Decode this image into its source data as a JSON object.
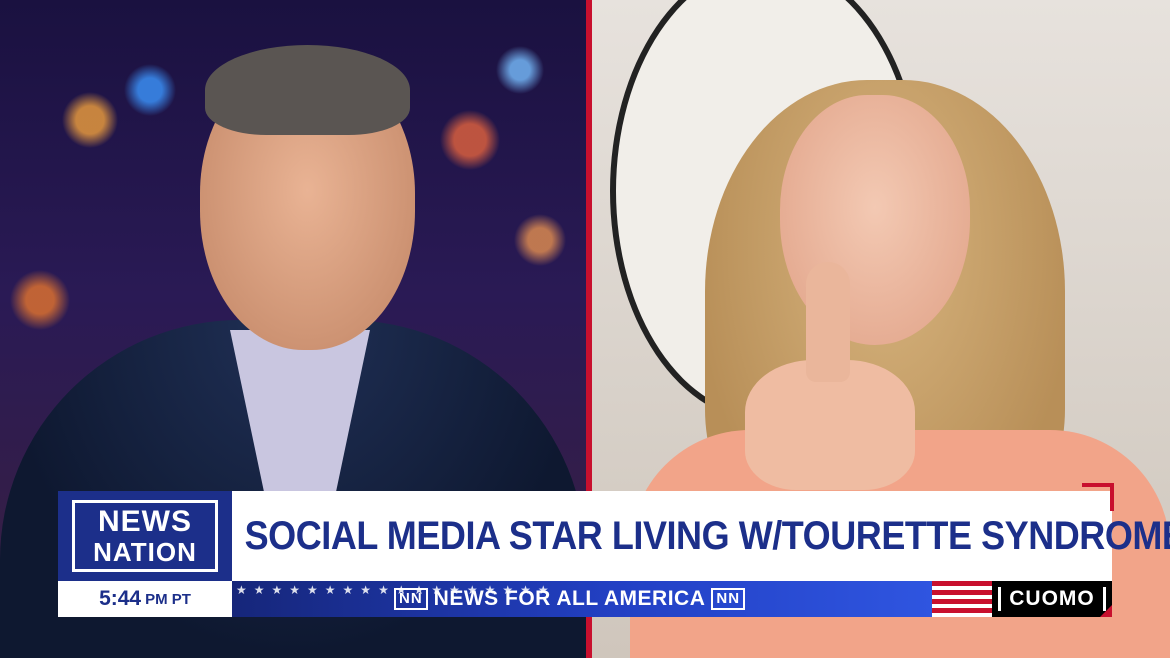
{
  "network": {
    "logo_line1": "NEWS",
    "logo_line2": "NATION",
    "brand_color": "#1c2f8a",
    "accent_color": "#c8102e"
  },
  "headline": "SOCIAL MEDIA STAR LIVING W/TOURETTE SYNDROME",
  "clock": {
    "time": "5:44",
    "suffix": "PM PT"
  },
  "ticker": {
    "nn_left": "NN",
    "tagline": "NEWS FOR ALL AMERICA",
    "nn_right": "NN",
    "stars": "★★★★★★★★★★★★★★★★★★"
  },
  "show": {
    "name": "CUOMO"
  },
  "panels": {
    "left": "host-video-feed",
    "right": "guest-video-feed"
  }
}
